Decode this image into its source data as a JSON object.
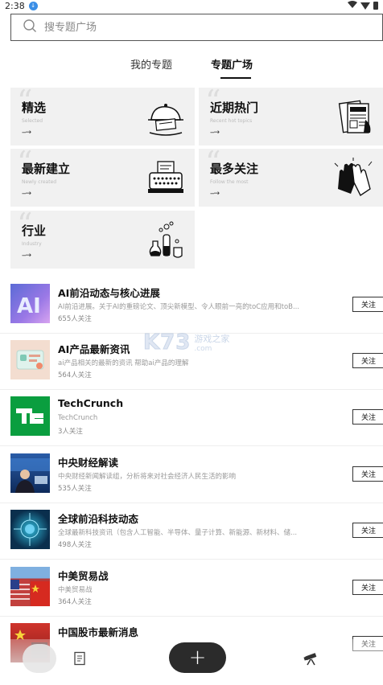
{
  "status_bar": {
    "time": "2:38"
  },
  "search": {
    "placeholder": "搜专题广场"
  },
  "tabs": [
    {
      "label": "我的专题",
      "active": false
    },
    {
      "label": "专题广场",
      "active": true
    }
  ],
  "categories": [
    {
      "title": "精选",
      "subtitle": "Selected",
      "arrow": "--→",
      "icon": "dome-plate-icon"
    },
    {
      "title": "近期热门",
      "subtitle": "Recent hot topics",
      "arrow": "--→",
      "icon": "newspaper-icon"
    },
    {
      "title": "最新建立",
      "subtitle": "Newly created",
      "arrow": "--→",
      "icon": "typewriter-icon"
    },
    {
      "title": "最多关注",
      "subtitle": "Follow the most",
      "arrow": "--→",
      "icon": "clapping-hands-icon"
    },
    {
      "title": "行业",
      "subtitle": "Industry",
      "arrow": "--→",
      "icon": "lab-flasks-icon"
    }
  ],
  "topics": [
    {
      "title": "AI前沿动态与核心进展",
      "desc": "AI前沿进展。关于AI的重磅论文、顶尖新模型、令人眼前一亮的toC应用和toB...",
      "count": "655人关注",
      "follow": "关注",
      "thumb_color": "#6a6fd8"
    },
    {
      "title": "AI产品最新资讯",
      "desc": "ai产品相关的最新的资讯 帮助ai产品的理解",
      "count": "564人关注",
      "follow": "关注",
      "thumb_color": "#f3ddd0"
    },
    {
      "title": "TechCrunch",
      "desc": "TechCrunch",
      "count": "3人关注",
      "follow": "关注",
      "thumb_color": "#0a9e3f"
    },
    {
      "title": "中央财经解读",
      "desc": "中央财经新闻解读组，分析将来对社会经济人民生活的影响",
      "count": "535人关注",
      "follow": "关注",
      "thumb_color": "#1d3f7a"
    },
    {
      "title": "全球前沿科技动态",
      "desc": "全球最新科技资讯（包含人工智能、半导体、量子计算、新能源、新材料、储...",
      "count": "498人关注",
      "follow": "关注",
      "thumb_color": "#0d4c6b"
    },
    {
      "title": "中美贸易战",
      "desc": "中美贸易战",
      "count": "364人关注",
      "follow": "关注",
      "thumb_color": "#b63a3a"
    },
    {
      "title": "中国股市最新消息",
      "desc": "",
      "count": "",
      "follow": "关注",
      "thumb_color": "#c8302a"
    }
  ],
  "watermark": {
    "logo": "K73",
    "cn": "游戏之家",
    "com": ".com"
  },
  "bottom_nav": {
    "add_label": "+"
  }
}
